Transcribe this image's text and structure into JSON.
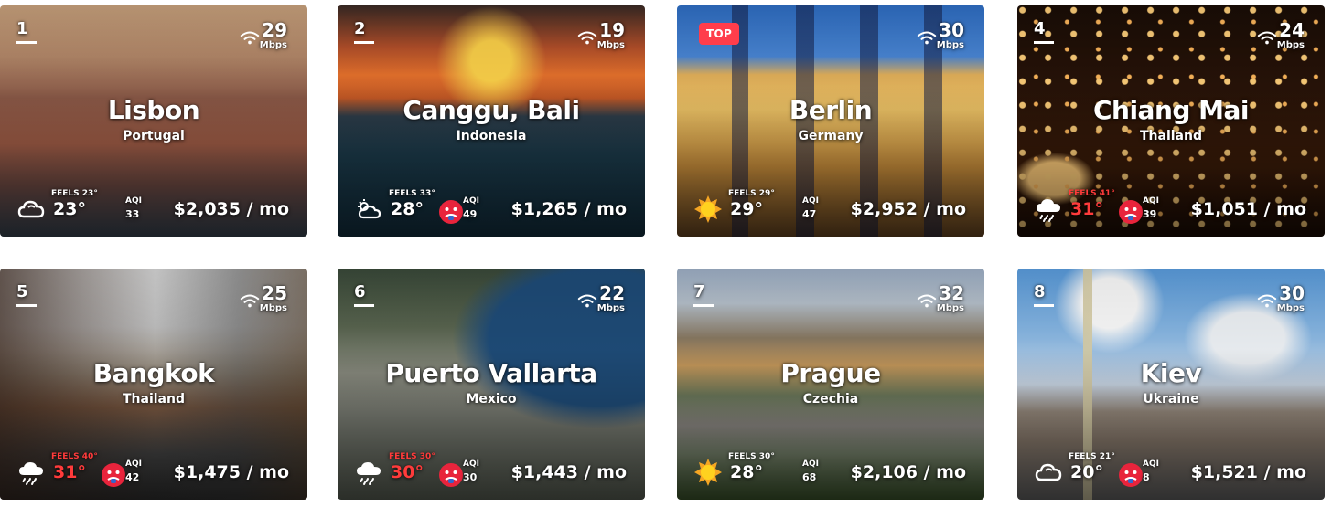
{
  "cities": [
    {
      "rank": "1",
      "top_badge": "",
      "name": "Lisbon",
      "country": "Portugal",
      "internet_value": "29",
      "internet_unit": "Mbps",
      "weather_icon": "cloudy-icon",
      "feels": "FEELS 23°",
      "feels_hot": false,
      "temp": "23°",
      "aqi_label": "AQI",
      "aqi": "33",
      "aqi_face": false,
      "price": "$2,035 / mo"
    },
    {
      "rank": "2",
      "top_badge": "",
      "name": "Canggu, Bali",
      "country": "Indonesia",
      "internet_value": "19",
      "internet_unit": "Mbps",
      "weather_icon": "partly-cloudy-icon",
      "feels": "FEELS 33°",
      "feels_hot": false,
      "temp": "28°",
      "aqi_label": "AQI",
      "aqi": "49",
      "aqi_face": true,
      "price": "$1,265 / mo"
    },
    {
      "rank": "",
      "top_badge": "TOP",
      "name": "Berlin",
      "country": "Germany",
      "internet_value": "30",
      "internet_unit": "Mbps",
      "weather_icon": "sun-icon",
      "feels": "FEELS 29°",
      "feels_hot": false,
      "temp": "29°",
      "aqi_label": "AQI",
      "aqi": "47",
      "aqi_face": false,
      "price": "$2,952 / mo"
    },
    {
      "rank": "4",
      "top_badge": "",
      "name": "Chiang Mai",
      "country": "Thailand",
      "internet_value": "24",
      "internet_unit": "Mbps",
      "weather_icon": "rain-icon",
      "feels": "FEELS 41°",
      "feels_hot": true,
      "temp": "31°",
      "aqi_label": "AQI",
      "aqi": "39",
      "aqi_face": true,
      "price": "$1,051 / mo"
    },
    {
      "rank": "5",
      "top_badge": "",
      "name": "Bangkok",
      "country": "Thailand",
      "internet_value": "25",
      "internet_unit": "Mbps",
      "weather_icon": "rain-icon",
      "feels": "FEELS 40°",
      "feels_hot": true,
      "temp": "31°",
      "aqi_label": "AQI",
      "aqi": "42",
      "aqi_face": true,
      "price": "$1,475 / mo"
    },
    {
      "rank": "6",
      "top_badge": "",
      "name": "Puerto Vallarta",
      "country": "Mexico",
      "internet_value": "22",
      "internet_unit": "Mbps",
      "weather_icon": "rain-icon",
      "feels": "FEELS 30°",
      "feels_hot": true,
      "temp": "30°",
      "aqi_label": "AQI",
      "aqi": "30",
      "aqi_face": true,
      "price": "$1,443 / mo"
    },
    {
      "rank": "7",
      "top_badge": "",
      "name": "Prague",
      "country": "Czechia",
      "internet_value": "32",
      "internet_unit": "Mbps",
      "weather_icon": "sun-icon",
      "feels": "FEELS 30°",
      "feels_hot": false,
      "temp": "28°",
      "aqi_label": "AQI",
      "aqi": "68",
      "aqi_face": false,
      "price": "$2,106 / mo"
    },
    {
      "rank": "8",
      "top_badge": "",
      "name": "Kiev",
      "country": "Ukraine",
      "internet_value": "30",
      "internet_unit": "Mbps",
      "weather_icon": "cloudy-icon",
      "feels": "FEELS 21°",
      "feels_hot": false,
      "temp": "20°",
      "aqi_label": "AQI",
      "aqi": "8",
      "aqi_face": true,
      "price": "$1,521 / mo"
    }
  ],
  "colors": {
    "hot_red": "#ff3b3b",
    "top_badge": "#ff3d4b",
    "aqi_face": "#e8243c"
  }
}
